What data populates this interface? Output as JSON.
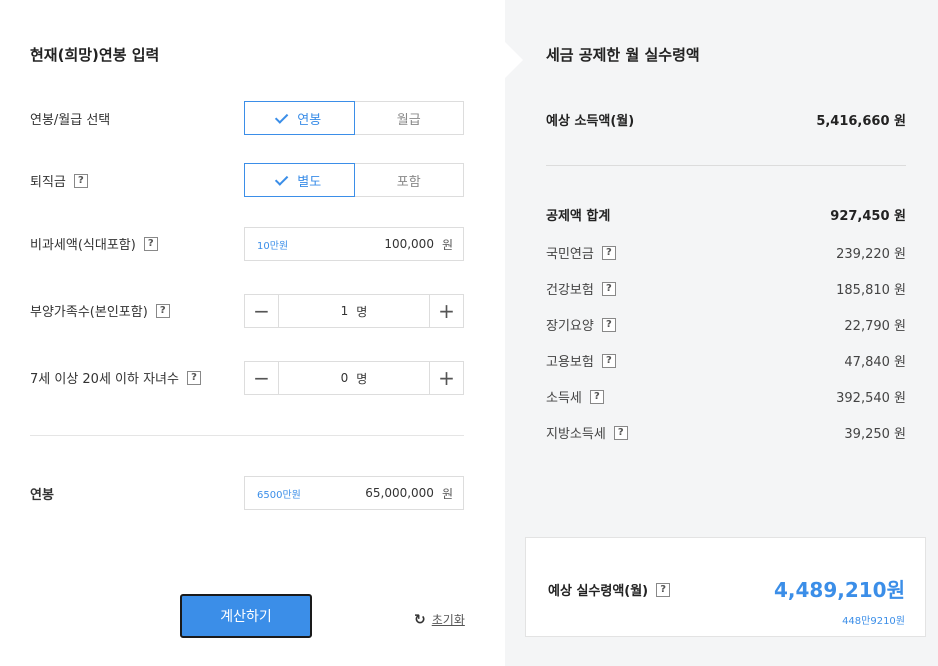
{
  "left": {
    "title": "현재(희망)연봉 입력",
    "salary_type": {
      "label": "연봉/월급 선택",
      "options": [
        "연봉",
        "월급"
      ],
      "selected": "연봉"
    },
    "severance": {
      "label": "퇴직금",
      "options": [
        "별도",
        "포함"
      ],
      "selected": "별도"
    },
    "nontaxable": {
      "label": "비과세액(식대포함)",
      "hint": "10만원",
      "value": "100,000",
      "unit": "원"
    },
    "dependents": {
      "label": "부양가족수(본인포함)",
      "value": "1",
      "unit": "명"
    },
    "children": {
      "label": "7세 이상 20세 이하 자녀수",
      "value": "0",
      "unit": "명"
    },
    "annual": {
      "label": "연봉",
      "hint": "6500만원",
      "value": "65,000,000",
      "unit": "원"
    },
    "calc_label": "계산하기",
    "reset_label": "초기화",
    "help_glyph": "?",
    "minus_glyph": "−",
    "plus_glyph": "+",
    "reset_glyph": "↻"
  },
  "right": {
    "title": "세금 공제한 월 실수령액",
    "expected_income": {
      "label": "예상 소득액(월)",
      "value": "5,416,660 원"
    },
    "deduction_total": {
      "label": "공제액 합계",
      "value": "927,450 원"
    },
    "items": [
      {
        "label": "국민연금",
        "value": "239,220 원"
      },
      {
        "label": "건강보험",
        "value": "185,810 원"
      },
      {
        "label": "장기요양",
        "value": "22,790 원"
      },
      {
        "label": "고용보험",
        "value": "47,840 원"
      },
      {
        "label": "소득세",
        "value": "392,540 원"
      },
      {
        "label": "지방소득세",
        "value": "39,250 원"
      }
    ],
    "result": {
      "label": "예상 실수령액(월)",
      "value": "4,489,210원",
      "sub": "448만9210원"
    }
  },
  "colors": {
    "accent": "#3b8ee8",
    "panel_bg": "#f4f5f6"
  }
}
